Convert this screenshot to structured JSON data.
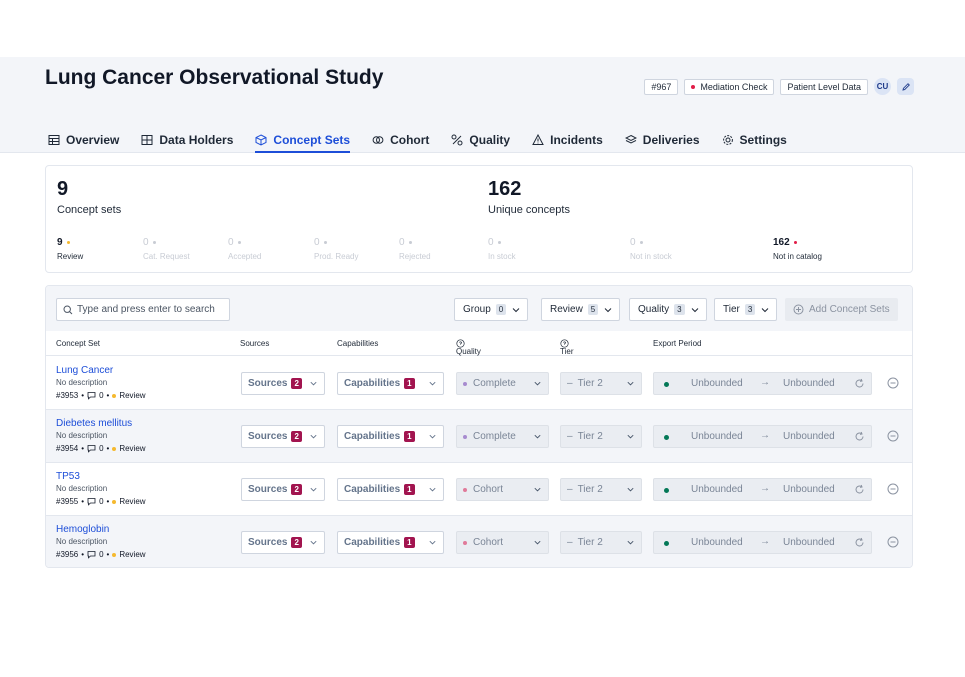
{
  "page": {
    "title": "Lung Cancer Observational Study",
    "badges": {
      "id": "#967",
      "check": "Mediation Check",
      "level": "Patient Level Data",
      "avatar": "CU"
    },
    "accent": "#1d4ed8",
    "review_dot": "#f5b92f",
    "alert_dot": "#e11d48"
  },
  "tabs": [
    {
      "label": "Overview",
      "icon": "table-icon"
    },
    {
      "label": "Data Holders",
      "icon": "database-icon"
    },
    {
      "label": "Concept Sets",
      "icon": "cube-icon",
      "active": true
    },
    {
      "label": "Cohort",
      "icon": "rings-icon"
    },
    {
      "label": "Quality",
      "icon": "scale-icon"
    },
    {
      "label": "Incidents",
      "icon": "warning-icon"
    },
    {
      "label": "Deliveries",
      "icon": "layers-icon"
    },
    {
      "label": "Settings",
      "icon": "gear-icon"
    }
  ],
  "stats": {
    "concept_sets": {
      "value": "9",
      "label": "Concept sets"
    },
    "unique_concepts": {
      "value": "162",
      "label": "Unique concepts"
    },
    "breakdown": [
      {
        "value": "9",
        "label": "Review"
      },
      {
        "value": "0",
        "label": "Cat. Request"
      },
      {
        "value": "0",
        "label": "Accepted"
      },
      {
        "value": "0",
        "label": "Prod. Ready"
      },
      {
        "value": "0",
        "label": "Rejected"
      },
      {
        "value": "0",
        "label": "In stock"
      },
      {
        "value": "0",
        "label": "Not in stock"
      },
      {
        "value": "162",
        "label": "Not in catalog"
      }
    ]
  },
  "toolbar": {
    "search_placeholder": "Type and press enter to search",
    "filters": [
      {
        "label": "Group",
        "count": "0"
      },
      {
        "label": "Review",
        "count": "5"
      },
      {
        "label": "Quality",
        "count": "3"
      },
      {
        "label": "Tier",
        "count": "3"
      }
    ],
    "add_label": "Add Concept Sets"
  },
  "columns": [
    "Concept Set",
    "Sources",
    "Capabilities",
    "Quality",
    "Tier",
    "Export Period"
  ],
  "rows": [
    {
      "name": "Lung Cancer",
      "desc": "No description",
      "id": "#3953",
      "comments": "0",
      "status": "Review",
      "sources": "Sources",
      "sources_n": "2",
      "caps": "Capabilities",
      "caps_n": "1",
      "quality": "Complete",
      "quality_color": "#a78bcf",
      "tier": "Tier 2",
      "from": "Unbounded",
      "to": "Unbounded"
    },
    {
      "name": "Diebetes mellitus",
      "desc": "No description",
      "id": "#3954",
      "comments": "0",
      "status": "Review",
      "sources": "Sources",
      "sources_n": "2",
      "caps": "Capabilities",
      "caps_n": "1",
      "quality": "Complete",
      "quality_color": "#a78bcf",
      "tier": "Tier 2",
      "from": "Unbounded",
      "to": "Unbounded"
    },
    {
      "name": "TP53",
      "desc": "No description",
      "id": "#3955",
      "comments": "0",
      "status": "Review",
      "sources": "Sources",
      "sources_n": "2",
      "caps": "Capabilities",
      "caps_n": "1",
      "quality": "Cohort",
      "quality_color": "#e07a9a",
      "tier": "Tier 2",
      "from": "Unbounded",
      "to": "Unbounded"
    },
    {
      "name": "Hemoglobin",
      "desc": "No description",
      "id": "#3956",
      "comments": "0",
      "status": "Review",
      "sources": "Sources",
      "sources_n": "2",
      "caps": "Capabilities",
      "caps_n": "1",
      "quality": "Cohort",
      "quality_color": "#e07a9a",
      "tier": "Tier 2",
      "from": "Unbounded",
      "to": "Unbounded"
    }
  ]
}
